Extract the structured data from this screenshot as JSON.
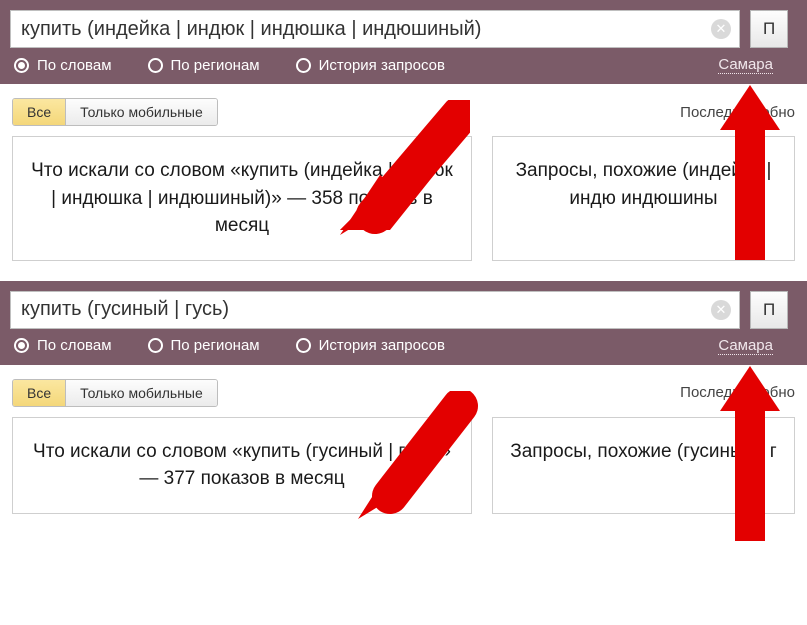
{
  "blocks": [
    {
      "search": {
        "query": "купить (индейка | индюк | индюшка | индюшиный)",
        "submit_label": "П"
      },
      "options": {
        "by_words": "По словам",
        "by_regions": "По регионам",
        "history": "История запросов",
        "region": "Самара"
      },
      "filters": {
        "all": "Все",
        "mobile_only": "Только мобильные",
        "last_update": "Последнее обно"
      },
      "panels": {
        "left": "Что искали со словом «купить (индейка | индюк | индюшка | индюшиный)» — 358 показов в месяц",
        "right": "Запросы, похожие (индейка | индю индюшины"
      }
    },
    {
      "search": {
        "query": "купить (гусиный | гусь)",
        "submit_label": "П"
      },
      "options": {
        "by_words": "По словам",
        "by_regions": "По регионам",
        "history": "История запросов",
        "region": "Самара"
      },
      "filters": {
        "all": "Все",
        "mobile_only": "Только мобильные",
        "last_update": "Последнее обно"
      },
      "panels": {
        "left": "Что искали со словом «купить (гусиный | гусь)» — 377 показов в месяц",
        "right": "Запросы, похожие (гусиный | г"
      }
    }
  ]
}
